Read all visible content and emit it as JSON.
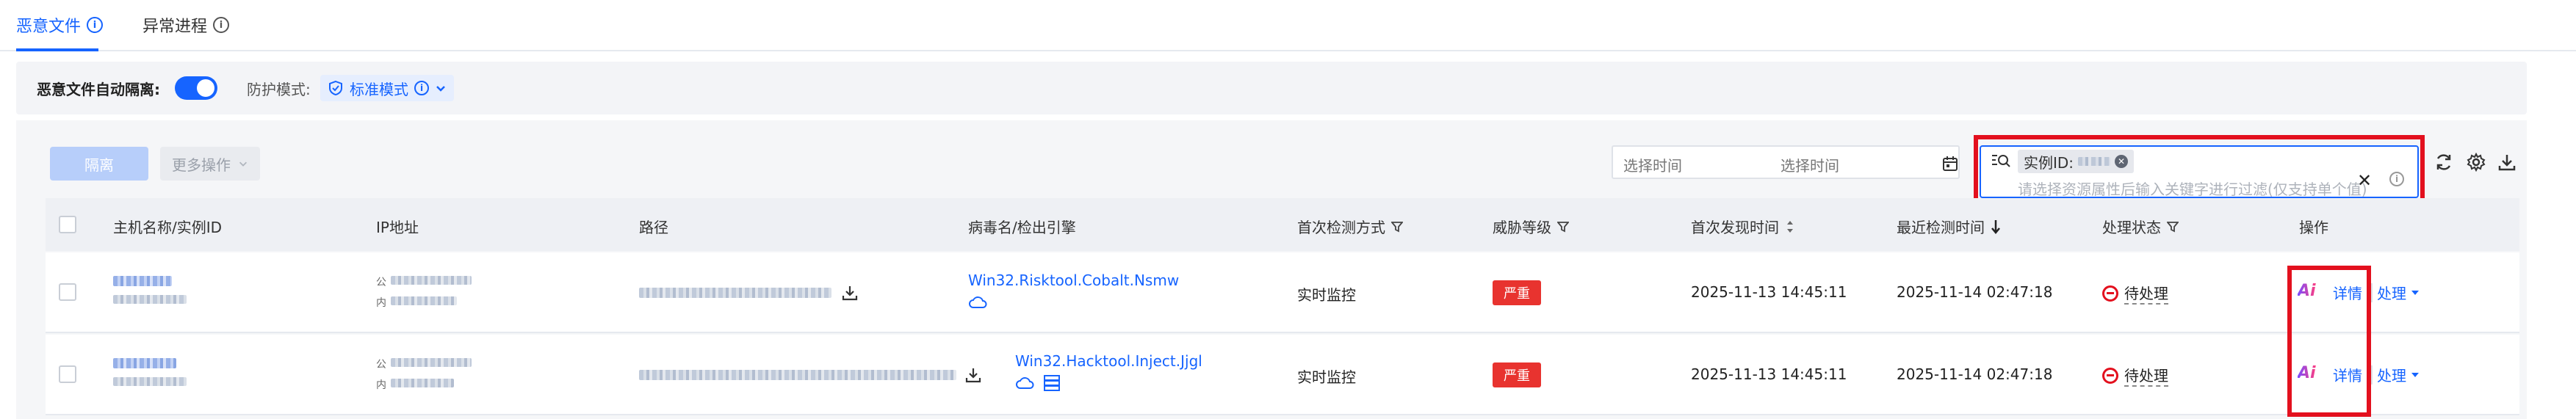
{
  "tabs": [
    {
      "label": "恶意文件",
      "active": true,
      "icon": "info-icon"
    },
    {
      "label": "异常进程",
      "active": false,
      "icon": "info-icon"
    }
  ],
  "settings": {
    "auto_isolation_label": "恶意文件自动隔离:",
    "auto_isolation_on": true,
    "protection_mode_label": "防护模式:",
    "protection_mode_value": "标准模式"
  },
  "toolbar": {
    "isolate_label": "隔离",
    "more_label": "更多操作",
    "start_time_placeholder": "选择时间",
    "end_time_placeholder": "选择时间",
    "filter_tag_label": "实例ID:",
    "filter_placeholder": "请选择资源属性后输入关键字进行过滤(仅支持单个值)"
  },
  "table": {
    "columns": [
      "主机名称/实例ID",
      "IP地址",
      "路径",
      "病毒名/检出引擎",
      "首次检测方式",
      "威胁等级",
      "首次发现时间",
      "最近检测时间",
      "处理状态",
      "操作"
    ],
    "public_prefix": "公",
    "private_prefix": "内",
    "rows": [
      {
        "virus_name": "Win32.Risktool.Cobalt.Nsmw",
        "engines": [
          "cloud-icon"
        ],
        "detect_method": "实时监控",
        "severity": "严重",
        "first_found": "2025-11-13 14:45:11",
        "last_detected": "2025-11-14 02:47:18",
        "status": "待处理",
        "ai_label": "Ai",
        "detail_label": "详情",
        "handle_label": "处理"
      },
      {
        "virus_name": "Win32.Hacktool.Inject.Jjgl",
        "engines": [
          "cloud-icon",
          "database-icon"
        ],
        "detect_method": "实时监控",
        "severity": "严重",
        "first_found": "2025-11-13 14:45:11",
        "last_detected": "2025-11-14 02:47:18",
        "status": "待处理",
        "ai_label": "Ai",
        "detail_label": "详情",
        "handle_label": "处理"
      }
    ]
  },
  "colors": {
    "accent": "#1664ff",
    "danger": "#e8332f",
    "highlight_box": "#e3101e"
  }
}
